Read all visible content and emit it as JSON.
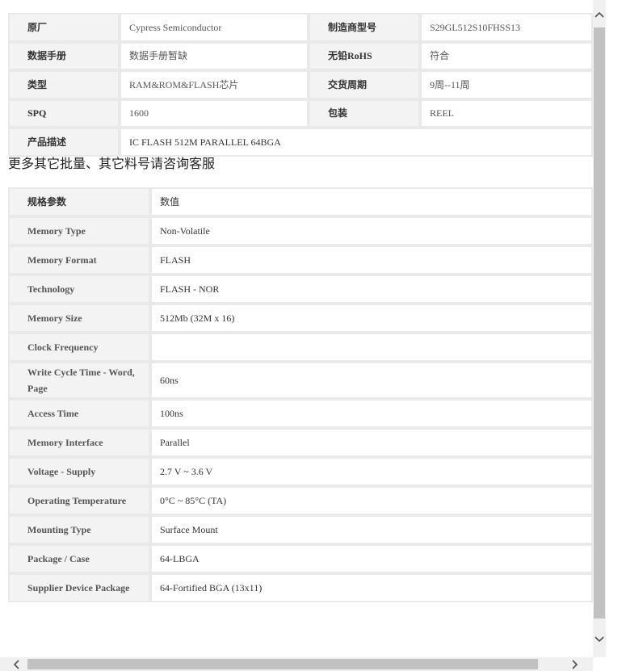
{
  "product_info": {
    "rows": [
      [
        {
          "label": "原厂",
          "value": "Cypress Semiconductor"
        },
        {
          "label": "制造商型号",
          "value": "S29GL512S10FHSS13"
        }
      ],
      [
        {
          "label": "数据手册",
          "value": "数据手册暂缺"
        },
        {
          "label": "无铅RoHS",
          "value": "符合"
        }
      ],
      [
        {
          "label": "类型",
          "value": "RAM&ROM&FLASH芯片"
        },
        {
          "label": "交货周期",
          "value": "9周--11周"
        }
      ],
      [
        {
          "label": "SPQ",
          "value": "1600"
        },
        {
          "label": "包装",
          "value": "REEL"
        }
      ]
    ],
    "description_label": "产品描述",
    "description_value": "IC FLASH 512M PARALLEL 64BGA"
  },
  "note": "更多其它批量、其它料号请咨询客服",
  "specs": {
    "header": {
      "key": "规格参数",
      "value": "数值"
    },
    "rows": [
      {
        "key": "Memory Type",
        "value": "Non-Volatile"
      },
      {
        "key": "Memory Format",
        "value": "FLASH"
      },
      {
        "key": "Technology",
        "value": "FLASH - NOR"
      },
      {
        "key": "Memory Size",
        "value": "512Mb (32M x 16)"
      },
      {
        "key": "Clock Frequency",
        "value": ""
      },
      {
        "key": "Write Cycle Time - Word, Page",
        "value": "60ns"
      },
      {
        "key": "Access Time",
        "value": "100ns"
      },
      {
        "key": "Memory Interface",
        "value": "Parallel"
      },
      {
        "key": "Voltage - Supply",
        "value": "2.7 V ~ 3.6 V"
      },
      {
        "key": "Operating Temperature",
        "value": "0°C ~ 85°C (TA)"
      },
      {
        "key": "Mounting Type",
        "value": "Surface Mount"
      },
      {
        "key": "Package / Case",
        "value": "64-LBGA"
      },
      {
        "key": "Supplier Device Package",
        "value": "64-Fortified BGA (13x11)"
      }
    ]
  },
  "scrollbar_icons": {
    "up": "▲-chevron-up-icon",
    "down": "chevron-down-icon",
    "left": "chevron-left-icon",
    "right": "chevron-right-icon"
  }
}
